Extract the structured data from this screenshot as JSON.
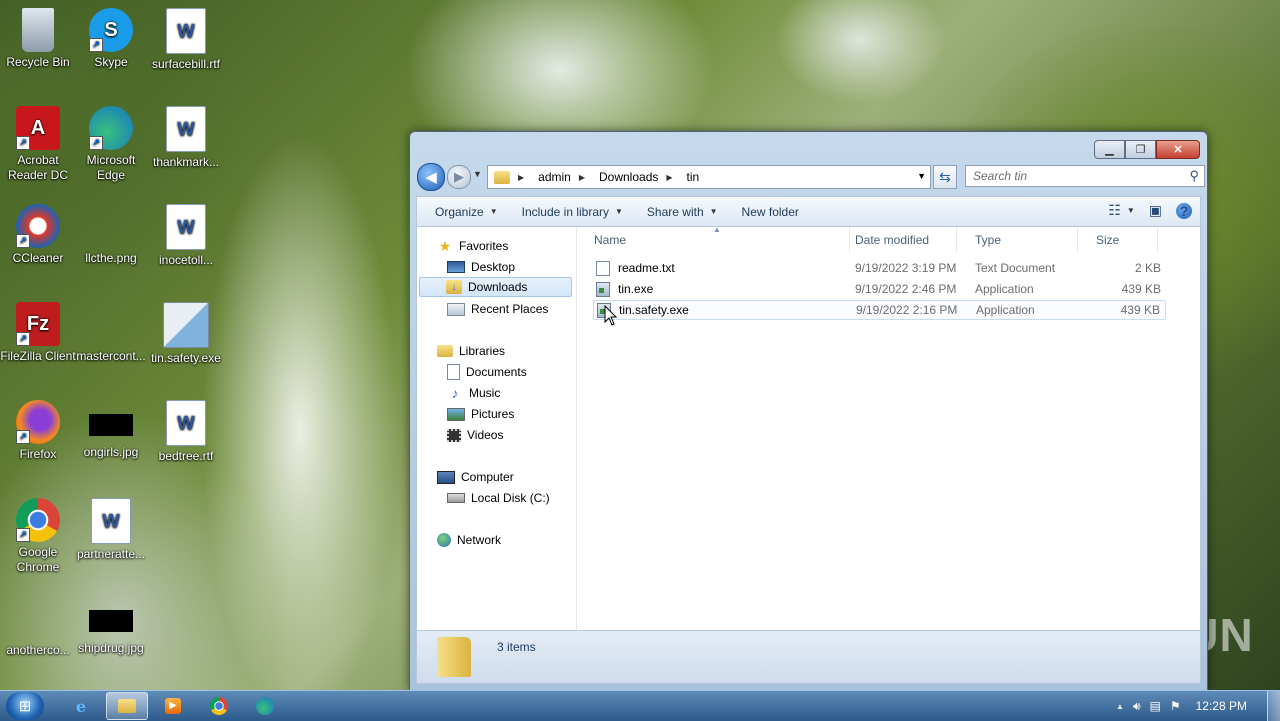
{
  "desktop": {
    "icons": [
      {
        "label": "Recycle Bin"
      },
      {
        "label": "Skype"
      },
      {
        "label": "surfacebill.rtf"
      },
      {
        "label": "Acrobat Reader DC"
      },
      {
        "label": "Microsoft Edge"
      },
      {
        "label": "thankmark..."
      },
      {
        "label": "CCleaner"
      },
      {
        "label": "llcthe.png"
      },
      {
        "label": "inocetoll..."
      },
      {
        "label": "FileZilla Client"
      },
      {
        "label": "mastercont..."
      },
      {
        "label": "tin.safety.exe"
      },
      {
        "label": "Firefox"
      },
      {
        "label": "ongirls.jpg"
      },
      {
        "label": "bedtree.rtf"
      },
      {
        "label": "Google Chrome"
      },
      {
        "label": "partneratte..."
      },
      {
        "label": "anotherco..."
      },
      {
        "label": "shipdrug.jpg"
      }
    ]
  },
  "explorer": {
    "address": {
      "crumbs": [
        "admin",
        "Downloads",
        "tin"
      ]
    },
    "search_placeholder": "Search tin",
    "toolbar": {
      "organize": "Organize",
      "include": "Include in library",
      "share": "Share with",
      "new_folder": "New folder"
    },
    "nav": {
      "favorites": "Favorites",
      "desktop": "Desktop",
      "downloads": "Downloads",
      "recent": "Recent Places",
      "libraries": "Libraries",
      "documents": "Documents",
      "music": "Music",
      "pictures": "Pictures",
      "videos": "Videos",
      "computer": "Computer",
      "local_disk": "Local Disk (C:)",
      "network": "Network"
    },
    "columns": {
      "name": "Name",
      "date": "Date modified",
      "type": "Type",
      "size": "Size"
    },
    "files": [
      {
        "name": "readme.txt",
        "date": "9/19/2022 3:19 PM",
        "type": "Text Document",
        "size": "2 KB"
      },
      {
        "name": "tin.exe",
        "date": "9/19/2022 2:46 PM",
        "type": "Application",
        "size": "439 KB"
      },
      {
        "name": "tin.safety.exe",
        "date": "9/19/2022 2:16 PM",
        "type": "Application",
        "size": "439 KB"
      }
    ],
    "status": "3 items"
  },
  "watermark": "ANY RUN",
  "taskbar": {
    "clock": "12:28 PM"
  }
}
